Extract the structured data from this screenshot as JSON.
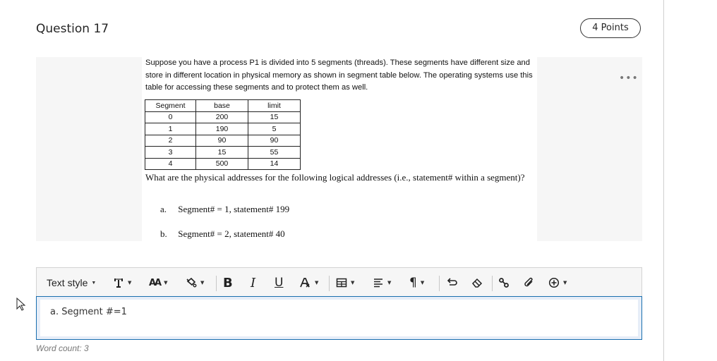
{
  "question": {
    "title": "Question 17",
    "points": "4 Points",
    "more_icon": "ellipsis-icon",
    "paragraph": "Suppose you have a process P1 is divided into 5 segments (threads). These segments have different size and store in different location in physical memory as shown in segment table below. The operating systems use this table for accessing these segments and to protect them as well.",
    "table": {
      "headers": [
        "Segment",
        "base",
        "limit"
      ],
      "rows": [
        [
          "0",
          "200",
          "15"
        ],
        [
          "1",
          "190",
          "5"
        ],
        [
          "2",
          "90",
          "90"
        ],
        [
          "3",
          "15",
          "55"
        ],
        [
          "4",
          "500",
          "14"
        ]
      ]
    },
    "ask": "What are the physical addresses for the following logical addresses (i.e., statement# within a segment)?",
    "items": [
      {
        "label": "a.",
        "text": "Segment# = 1, statement# 199"
      },
      {
        "label": "b.",
        "text": "Segment# = 2, statement# 40"
      }
    ]
  },
  "toolbar": {
    "text_style": "Text style",
    "icons": [
      "font-icon",
      "font-size-icon",
      "highlight-color-icon",
      "bold-icon",
      "italic-icon",
      "underline-icon",
      "text-format-icon",
      "table-icon",
      "align-icon",
      "paragraph-icon",
      "undo-icon",
      "eraser-icon",
      "link-icon",
      "attachment-icon",
      "insert-icon"
    ],
    "glyphs": {
      "bold": "B",
      "italic": "I",
      "underline": "U",
      "paragraph": "¶",
      "font_size": "AA"
    }
  },
  "editor": {
    "value": "a. Segment #=1"
  },
  "word_count": "Word count: 3"
}
